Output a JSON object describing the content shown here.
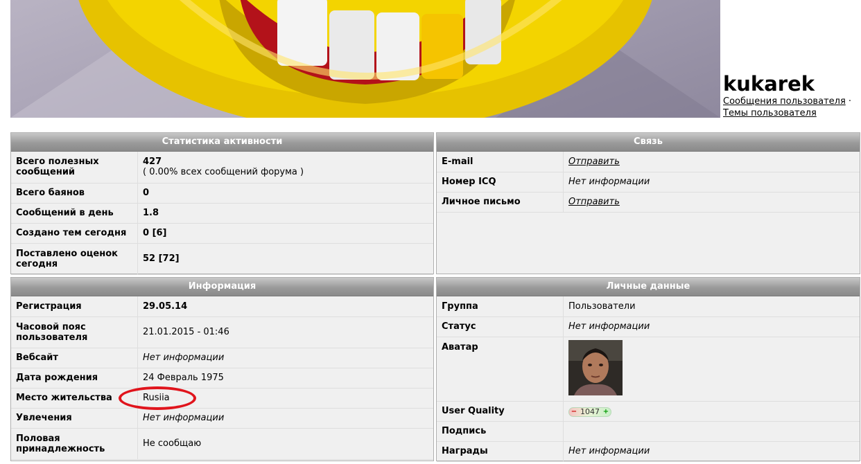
{
  "profile": {
    "username": "kukarek",
    "links": [
      "Сообщения пользователя",
      "Темы пользователя"
    ],
    "separator": " ·"
  },
  "stats": {
    "title": "Статистика активности",
    "rows": [
      {
        "label": "Всего полезных сообщений",
        "value": "427",
        "sub": "( 0.00% всех сообщений форума )"
      },
      {
        "label": "Всего баянов",
        "value": "0"
      },
      {
        "label": "Сообщений в день",
        "value": "1.8"
      },
      {
        "label": "Создано тем сегодня",
        "value": "0 [6]"
      },
      {
        "label": "Поставлено оценок сегодня",
        "value": "52 [72]"
      }
    ]
  },
  "contact": {
    "title": "Связь",
    "rows": [
      {
        "label": "E-mail",
        "value": "Отправить"
      },
      {
        "label": "Номер ICQ",
        "value": "Нет информации"
      },
      {
        "label": "Личное письмо",
        "value": "Отправить"
      }
    ]
  },
  "info": {
    "title": "Информация",
    "rows": [
      {
        "label": "Регистрация",
        "value": "29.05.14"
      },
      {
        "label": "Часовой пояс пользователя",
        "value": "21.01.2015 - 01:46"
      },
      {
        "label": "Вебсайт",
        "value": "Нет информации"
      },
      {
        "label": "Дата рождения",
        "value": "24 Февраль 1975"
      },
      {
        "label": "Место жительства",
        "value": "Rusiia"
      },
      {
        "label": "Увлечения",
        "value": "Нет информации"
      },
      {
        "label": "Половая принадлежность",
        "value": "Не сообщаю"
      }
    ]
  },
  "personal": {
    "title": "Личные данные",
    "rows": [
      {
        "label": "Группа",
        "value": "Пользователи"
      },
      {
        "label": "Статус",
        "value": "Нет информации"
      },
      {
        "label": "Аватар",
        "value": ""
      },
      {
        "label": "User Quality",
        "value": "1047",
        "minus": "−",
        "plus": "+"
      },
      {
        "label": "Подпись",
        "value": ""
      },
      {
        "label": "Награды",
        "value": "Нет информации"
      }
    ]
  },
  "colors": {
    "header_gradient_top": "#c8c8c8",
    "header_gradient_bottom": "#8a8a8a",
    "panel_bg": "#f0f0f0",
    "annotation_circle": "#e0141c"
  }
}
